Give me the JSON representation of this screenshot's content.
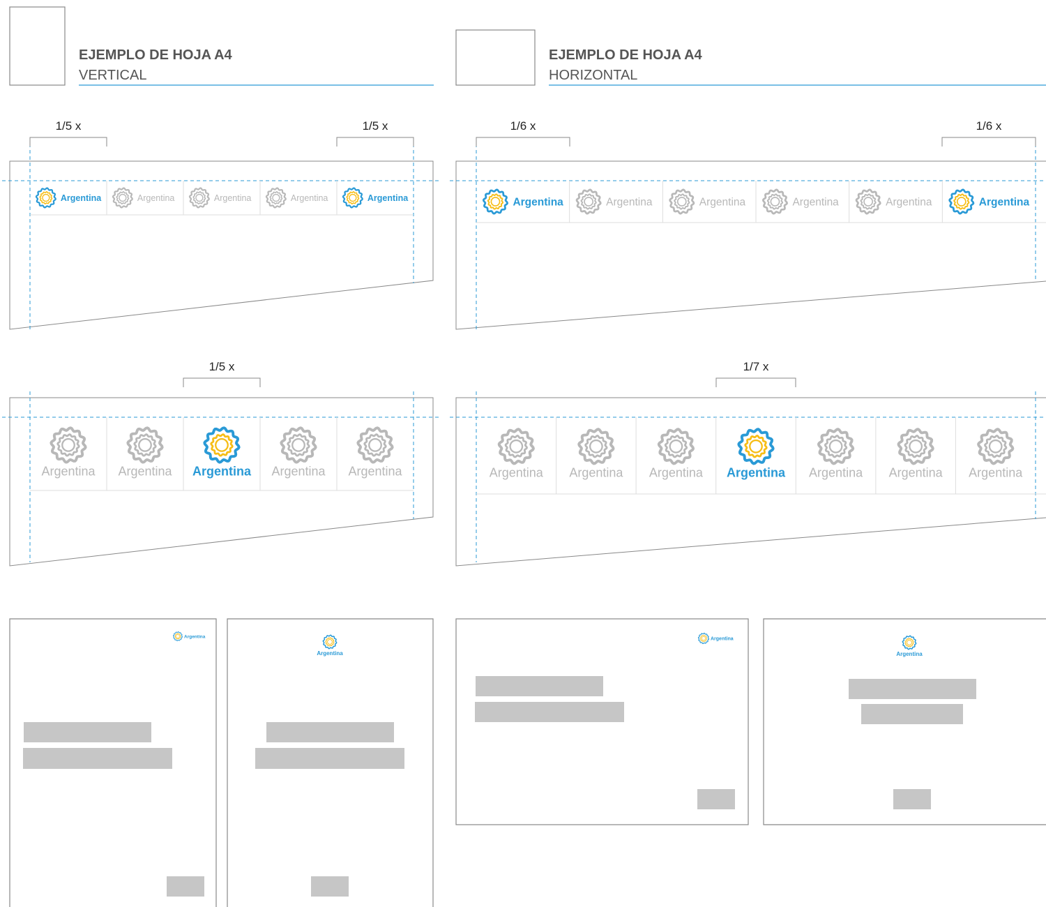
{
  "brand_name": "Argentina",
  "colors": {
    "accent_blue": "#2a9ad6",
    "sun_yellow": "#f6bd16",
    "inactive_gray": "#b8b8b8",
    "outline": "#888888",
    "guide": "#2a9ad6",
    "placeholder_block": "#c6c6c6"
  },
  "vertical": {
    "title": "EJEMPLO DE HOJA A4",
    "subtitle": "VERTICAL",
    "top_header": {
      "measure_left": "1/5 x",
      "measure_right": "1/5 x",
      "columns": 5,
      "active_columns": [
        0,
        4
      ]
    },
    "center_header": {
      "measure": "1/5 x",
      "columns": 5,
      "active_columns": [
        2
      ]
    }
  },
  "horizontal": {
    "title": "EJEMPLO DE HOJA A4",
    "subtitle": "HORIZONTAL",
    "top_header": {
      "measure_left": "1/6 x",
      "measure_right": "1/6 x",
      "columns": 6,
      "active_columns": [
        0,
        5
      ]
    },
    "center_header": {
      "measure": "1/7 x",
      "columns": 7,
      "active_columns": [
        3
      ]
    }
  },
  "page_examples": [
    {
      "orientation": "vertical",
      "logo_alignment": "right",
      "logo_layout": "inline"
    },
    {
      "orientation": "vertical",
      "logo_alignment": "center",
      "logo_layout": "stacked"
    },
    {
      "orientation": "horizontal",
      "logo_alignment": "right",
      "logo_layout": "inline"
    },
    {
      "orientation": "horizontal",
      "logo_alignment": "center",
      "logo_layout": "stacked"
    }
  ],
  "icons": {
    "logo_mark": "sun-seal-icon",
    "page_thumbnail": "page-outline-icon"
  }
}
